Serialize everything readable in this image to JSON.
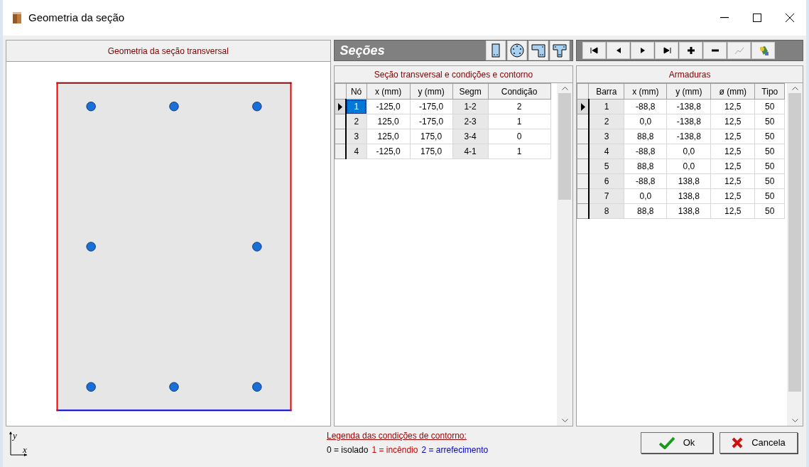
{
  "window": {
    "title": "Geometria da seção"
  },
  "geometry_panel": {
    "title": "Geometria da seção transversal",
    "axis_y": "y",
    "axis_x": "x"
  },
  "sections_panel": {
    "title": "Seções",
    "shape_buttons": [
      {
        "kind": "rectangle"
      },
      {
        "kind": "circle"
      },
      {
        "kind": "l-shape"
      },
      {
        "kind": "t-shape"
      }
    ]
  },
  "nav_buttons": [
    {
      "kind": "first",
      "disabled": false
    },
    {
      "kind": "prev",
      "disabled": false
    },
    {
      "kind": "next",
      "disabled": false
    },
    {
      "kind": "last",
      "disabled": false
    },
    {
      "kind": "add",
      "disabled": false
    },
    {
      "kind": "remove",
      "disabled": false
    },
    {
      "kind": "curve",
      "disabled": true
    },
    {
      "kind": "paint",
      "disabled": false
    }
  ],
  "nodes_table": {
    "title": "Seção transversal e condições e contorno",
    "columns": [
      "Nó",
      "x (mm)",
      "y (mm)",
      "Segm",
      "Condição"
    ],
    "rows": [
      {
        "cells": [
          "1",
          "-125,0",
          "-175,0",
          "1-2",
          "2"
        ],
        "selected": true,
        "color": "#0000ee"
      },
      {
        "cells": [
          "2",
          "125,0",
          "-175,0",
          "2-3",
          "1"
        ],
        "selected": false,
        "color": "#ee0000"
      },
      {
        "cells": [
          "3",
          "125,0",
          "175,0",
          "3-4",
          "0"
        ],
        "selected": false,
        "color": "#7a1010"
      },
      {
        "cells": [
          "4",
          "-125,0",
          "175,0",
          "4-1",
          "1"
        ],
        "selected": false,
        "color": "#ee0000"
      }
    ]
  },
  "bars_table": {
    "title": "Armaduras",
    "columns": [
      "Barra",
      "x (mm)",
      "y (mm)",
      "ø (mm)",
      "Tipo"
    ],
    "rows": [
      {
        "cells": [
          "1",
          "-88,8",
          "-138,8",
          "12,5",
          "50"
        ],
        "selected": true
      },
      {
        "cells": [
          "2",
          "0,0",
          "-138,8",
          "12,5",
          "50"
        ],
        "selected": false
      },
      {
        "cells": [
          "3",
          "88,8",
          "-138,8",
          "12,5",
          "50"
        ],
        "selected": false
      },
      {
        "cells": [
          "4",
          "-88,8",
          "0,0",
          "12,5",
          "50"
        ],
        "selected": false
      },
      {
        "cells": [
          "5",
          "88,8",
          "0,0",
          "12,5",
          "50"
        ],
        "selected": false
      },
      {
        "cells": [
          "6",
          "-88,8",
          "138,8",
          "12,5",
          "50"
        ],
        "selected": false
      },
      {
        "cells": [
          "7",
          "0,0",
          "138,8",
          "12,5",
          "50"
        ],
        "selected": false
      },
      {
        "cells": [
          "8",
          "88,8",
          "138,8",
          "12,5",
          "50"
        ],
        "selected": false
      }
    ]
  },
  "legend": {
    "title": "Legenda das condições de contorno:",
    "items": [
      {
        "text": "0 = isolado",
        "color": "#000000"
      },
      {
        "text": "1 = incêndio",
        "color": "#cc0000"
      },
      {
        "text": "2 = arrefecimento",
        "color": "#0000cc"
      }
    ]
  },
  "buttons": [
    {
      "kind": "ok",
      "label": "Ok"
    },
    {
      "kind": "cancel",
      "label": "Cancela"
    }
  ]
}
